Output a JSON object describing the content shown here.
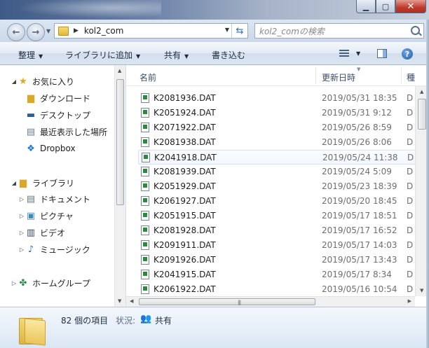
{
  "window": {
    "address_path": "kol2_com",
    "search_placeholder": "kol2_comの検索"
  },
  "toolbar": {
    "organize": "整理",
    "add_to_library": "ライブラリに追加",
    "share": "共有",
    "burn": "書き込む"
  },
  "nav": {
    "favorites": "お気に入り",
    "downloads": "ダウンロード",
    "desktop": "デスクトップ",
    "recent": "最近表示した場所",
    "dropbox": "Dropbox",
    "libraries": "ライブラリ",
    "documents": "ドキュメント",
    "pictures": "ピクチャ",
    "videos": "ビデオ",
    "music": "ミュージック",
    "homegroup": "ホームグループ"
  },
  "columns": {
    "name": "名前",
    "date": "更新日時",
    "type": "種"
  },
  "files": [
    {
      "name": "K2081936.DAT",
      "date": "2019/05/31 18:35",
      "type": "D"
    },
    {
      "name": "K2051924.DAT",
      "date": "2019/05/31 9:12",
      "type": "D"
    },
    {
      "name": "K2071922.DAT",
      "date": "2019/05/26 8:59",
      "type": "D"
    },
    {
      "name": "K2081938.DAT",
      "date": "2019/05/26 8:06",
      "type": "D"
    },
    {
      "name": "K2041918.DAT",
      "date": "2019/05/24 11:38",
      "type": "D"
    },
    {
      "name": "K2081939.DAT",
      "date": "2019/05/24 5:09",
      "type": "D"
    },
    {
      "name": "K2051929.DAT",
      "date": "2019/05/23 18:39",
      "type": "D"
    },
    {
      "name": "K2061927.DAT",
      "date": "2019/05/20 18:45",
      "type": "D"
    },
    {
      "name": "K2051915.DAT",
      "date": "2019/05/17 18:51",
      "type": "D"
    },
    {
      "name": "K2081928.DAT",
      "date": "2019/05/17 16:52",
      "type": "D"
    },
    {
      "name": "K2091911.DAT",
      "date": "2019/05/17 14:03",
      "type": "D"
    },
    {
      "name": "K2091926.DAT",
      "date": "2019/05/17 13:43",
      "type": "D"
    },
    {
      "name": "K2041915.DAT",
      "date": "2019/05/17 8:34",
      "type": "D"
    },
    {
      "name": "K2061922.DAT",
      "date": "2019/05/16 10:54",
      "type": "D"
    }
  ],
  "details": {
    "item_count": "82 個の項目",
    "status_label": "状況:",
    "status_value": "共有"
  }
}
